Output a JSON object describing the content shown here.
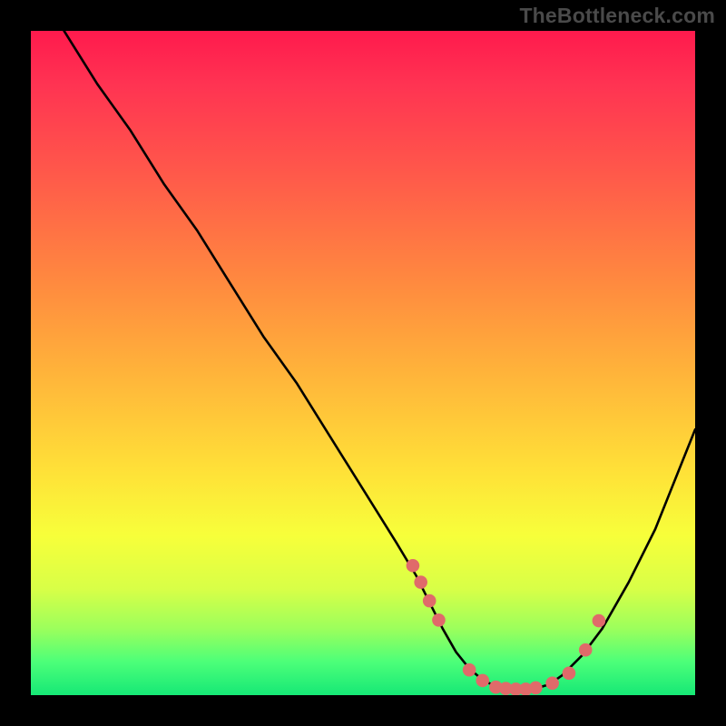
{
  "watermark": "TheBottleneck.com",
  "chart_data": {
    "type": "line",
    "title": "",
    "xlabel": "",
    "ylabel": "",
    "xlim": [
      0,
      100
    ],
    "ylim": [
      0,
      100
    ],
    "series": [
      {
        "name": "curve",
        "x": [
          5,
          10,
          15,
          20,
          25,
          30,
          35,
          40,
          45,
          50,
          55,
          58,
          60,
          62,
          64,
          66,
          68,
          70,
          72,
          74,
          76,
          78,
          80,
          83,
          86,
          90,
          94,
          100
        ],
        "y": [
          100,
          92,
          85,
          77,
          70,
          62,
          54,
          47,
          39,
          31,
          23,
          18,
          14,
          10,
          6.5,
          4,
          2.3,
          1.3,
          0.9,
          0.8,
          1.0,
          1.6,
          3,
          6,
          10,
          17,
          25,
          40
        ]
      }
    ],
    "markers": {
      "name": "dots",
      "color": "#e06a6a",
      "x": [
        57.5,
        58.7,
        60.0,
        61.4,
        66.0,
        68.0,
        70.0,
        71.5,
        73.0,
        74.5,
        76.0,
        78.5,
        81.0,
        83.5,
        85.5
      ],
      "y": [
        19.5,
        17.0,
        14.2,
        11.3,
        3.8,
        2.2,
        1.2,
        1.0,
        0.9,
        0.9,
        1.1,
        1.8,
        3.3,
        6.8,
        11.2
      ]
    },
    "gradient_colors": {
      "top": "#ff1a4d",
      "mid_upper": "#ff8a3f",
      "mid": "#ffe038",
      "mid_lower": "#d8ff47",
      "bottom": "#16e876"
    }
  }
}
